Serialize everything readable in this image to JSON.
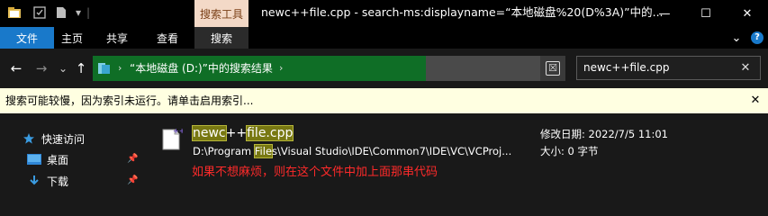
{
  "titlebar": {
    "contextual_tab": "搜索工具",
    "window_title": "newc++file.cpp - search-ms:displayname=“本地磁盘%20(D%3A)”中的...",
    "quick_access_down": "▾",
    "minimize": "—",
    "maximize": "☐",
    "close": "✕"
  },
  "ribbon": {
    "tabs": [
      "文件",
      "主页",
      "共享",
      "查看",
      "搜索"
    ],
    "expand": "⌄",
    "help": "?"
  },
  "nav": {
    "back": "←",
    "forward": "→",
    "recent": "⌄",
    "up": "↑",
    "chevron": "›",
    "path_text": "“本地磁盘 (D:)”中的搜索结果",
    "progress_fraction": 0.745
  },
  "search": {
    "value": "newc++file.cpp",
    "clear": "✕",
    "stop": "☒"
  },
  "infobar": {
    "text": "搜索可能较慢，因为索引未运行。请单击启用索引...",
    "close": "✕"
  },
  "sidebar": {
    "items": [
      {
        "label": "快速访问",
        "icon": "star-icon"
      },
      {
        "label": "桌面",
        "icon": "desktop-icon",
        "pin": "📌"
      },
      {
        "label": "下载",
        "icon": "download-icon",
        "pin": "📌"
      }
    ]
  },
  "result": {
    "name_parts": [
      "newc",
      "++",
      "file.cpp"
    ],
    "path_before": "D:\\Program ",
    "path_hl": "File",
    "path_after": "s\\Visual Studio\\IDE\\Common7\\IDE\\VC\\VCProj...",
    "modified_label": "修改日期:",
    "modified_value": "2022/7/5 11:01",
    "size_label": "大小:",
    "size_value": "0 字节"
  },
  "annotation": "如果不想麻烦，则在这个文件中加上面那串代码",
  "colors": {
    "accent_blue": "#1979ca",
    "search_tools_bg": "#f3d9c7",
    "progress_green": "#0f6e26",
    "highlight": "#787812",
    "annotation_red": "#ff2a2a",
    "info_bg": "#ffffe1"
  }
}
